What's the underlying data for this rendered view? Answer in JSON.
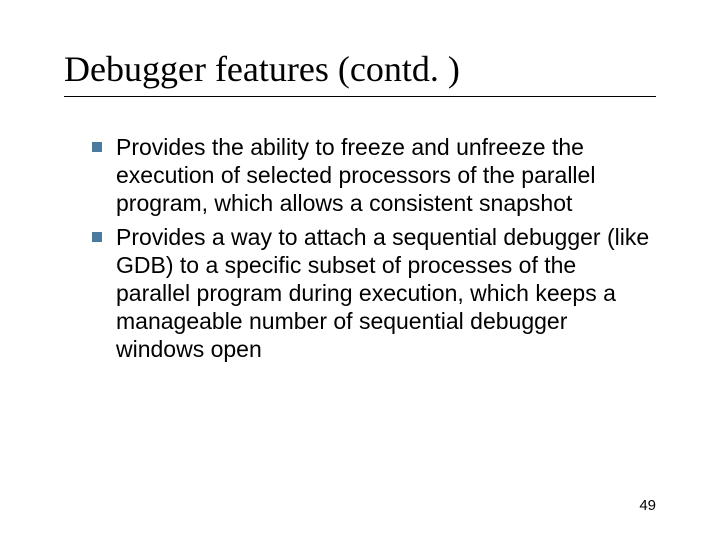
{
  "title": "Debugger features (contd. )",
  "bullets": [
    "Provides the ability to freeze and unfreeze the execution of selected processors of the parallel program, which allows a consistent snapshot",
    "Provides a way to attach a sequential debugger (like GDB) to a specific subset of processes of the parallel program during execution, which keeps a manageable number of sequential debugger windows open"
  ],
  "page_number": "49",
  "colors": {
    "bullet_marker": "#4a7a9e"
  }
}
